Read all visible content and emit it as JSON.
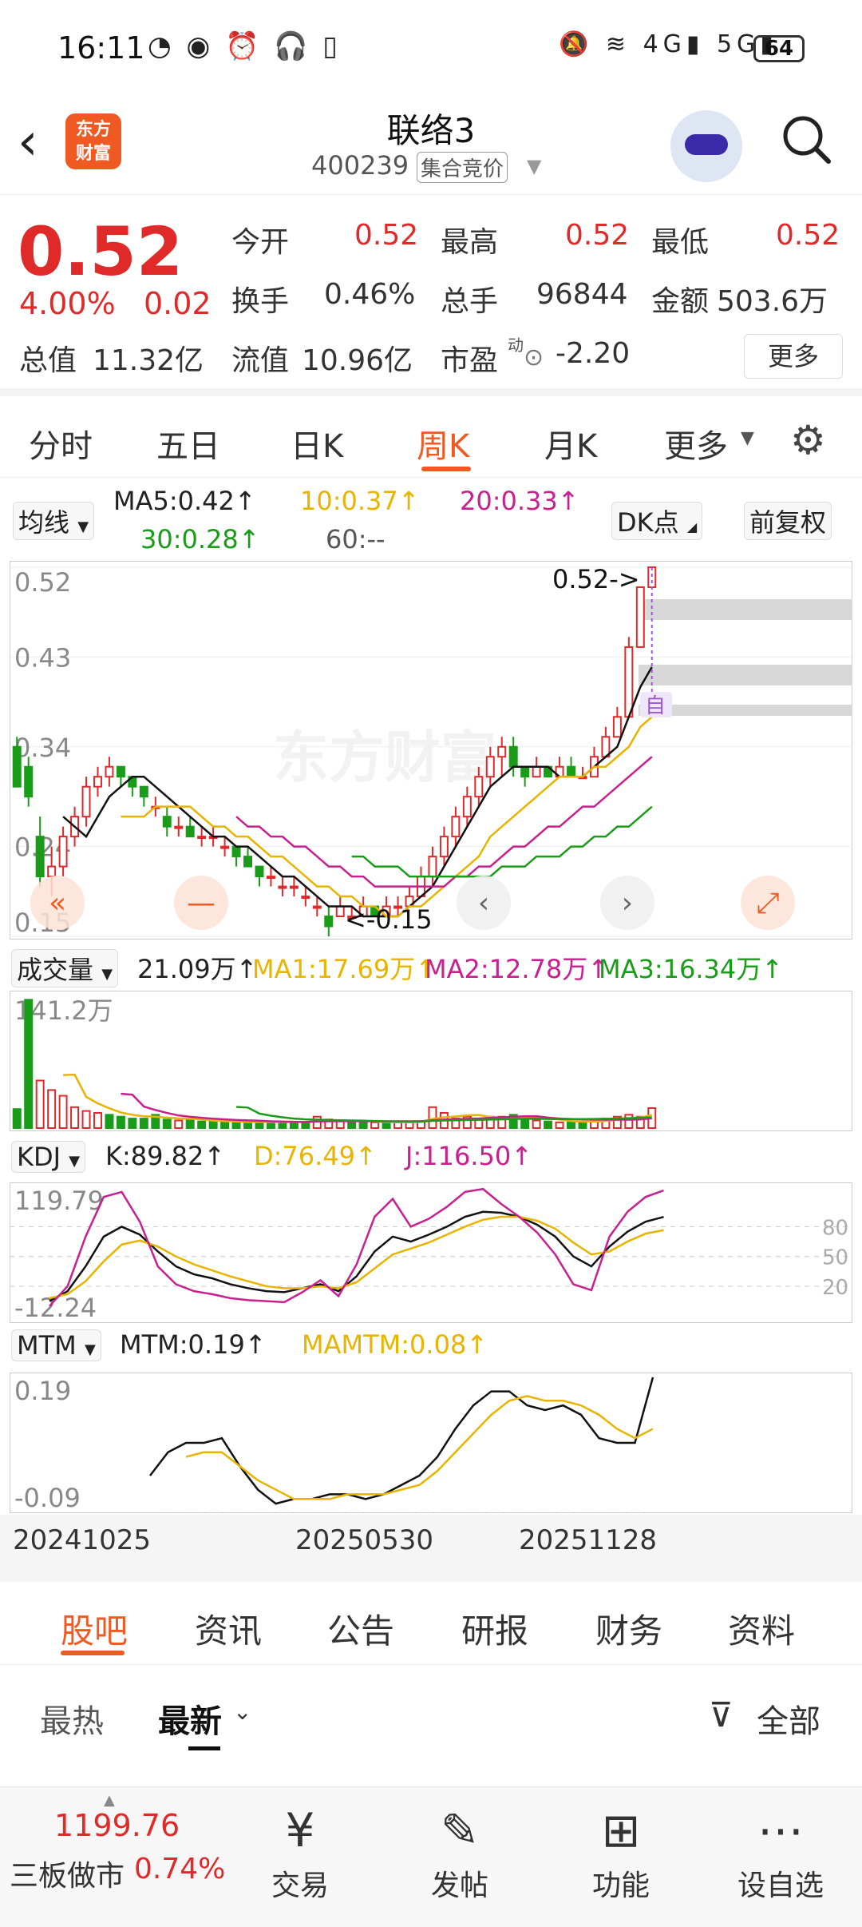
{
  "status_bar": {
    "time": "16:11",
    "left_icons": "◔ ◉ ⏰ 🎧 ▯",
    "right_icons": "🔕 ≋ 4G▮ 5G▮",
    "battery": "64"
  },
  "header": {
    "title": "联络3",
    "code": "400239",
    "badge": "集合竞价",
    "logo_text": "东方财富"
  },
  "quote": {
    "price": "0.52",
    "change_pct": "4.00%",
    "change": "0.02",
    "open_label": "今开",
    "open": "0.52",
    "high_label": "最高",
    "high": "0.52",
    "low_label": "最低",
    "low": "0.52",
    "turnover_label": "换手",
    "turnover": "0.46%",
    "volume_label": "总手",
    "volume": "96844",
    "amount_label": "金额",
    "amount": "503.6万",
    "total_cap_label": "总值",
    "total_cap": "11.32亿",
    "float_cap_label": "流值",
    "float_cap": "10.96亿",
    "pe_label": "市盈",
    "pe_sup": "动",
    "pe": "-2.20",
    "more_label": "更多"
  },
  "period_tabs": [
    "分时",
    "五日",
    "日K",
    "周K",
    "月K",
    "更多"
  ],
  "active_period": "周K",
  "kline_panel": {
    "indicator_label": "均线",
    "ma5": "MA5:0.42↑",
    "ma10": "10:0.37↑",
    "ma20": "20:0.33↑",
    "ma30": "30:0.28↑",
    "ma60": "60:--",
    "dk_label": "DK点",
    "adjust_label": "前复权",
    "y_labels": [
      "0.52",
      "0.43",
      "0.34",
      "0.24",
      "0.15"
    ],
    "max_marker": "0.52->",
    "min_marker": "<-0.15",
    "zi_label": "自",
    "watermark": "东方财富"
  },
  "volume_panel": {
    "label": "成交量",
    "value": "21.09万↑",
    "ma1": "MA1:17.69万↑",
    "ma2": "MA2:12.78万↑",
    "ma3": "MA3:16.34万↑",
    "y_max": "141.2万"
  },
  "kdj_panel": {
    "label": "KDJ",
    "k": "K:89.82↑",
    "d": "D:76.49↑",
    "j": "J:116.50↑",
    "y_top": "119.79",
    "y_bottom": "-12.24",
    "levels": [
      "80",
      "50",
      "20"
    ]
  },
  "mtm_panel": {
    "label": "MTM",
    "mtm": "MTM:0.19↑",
    "mamtm": "MAMTM:0.08↑",
    "y_top": "0.19",
    "y_bottom": "-0.09"
  },
  "x_dates": [
    "20241025",
    "20250530",
    "20251128"
  ],
  "bottom_tabs": [
    "股吧",
    "资讯",
    "公告",
    "研报",
    "财务",
    "资料"
  ],
  "active_bottom_tab": "股吧",
  "sub_tabs": {
    "hot": "最热",
    "latest": "最新",
    "filter": "全部"
  },
  "footer": {
    "index_value": "1199.76",
    "index_name": "三板做市",
    "index_pct": "0.74%",
    "items": [
      "交易",
      "发帖",
      "功能",
      "设自选"
    ]
  },
  "colors": {
    "up": "#e02a2a",
    "down": "#1a9c1a",
    "accent": "#ef5a23",
    "ma10": "#e8b400",
    "ma20": "#c8208e",
    "ma30": "#1a9c1a"
  },
  "chart_data": [
    {
      "type": "candlestick",
      "title": "",
      "ylim": [
        0.15,
        0.52
      ],
      "x_range": [
        "20241025",
        "20251128"
      ],
      "ohlc": [
        [
          0.34,
          0.35,
          0.3,
          0.3
        ],
        [
          0.32,
          0.33,
          0.28,
          0.29
        ],
        [
          0.25,
          0.27,
          0.2,
          0.21
        ],
        [
          0.21,
          0.24,
          0.19,
          0.22
        ],
        [
          0.22,
          0.26,
          0.21,
          0.25
        ],
        [
          0.25,
          0.28,
          0.24,
          0.27
        ],
        [
          0.27,
          0.31,
          0.26,
          0.3
        ],
        [
          0.3,
          0.32,
          0.29,
          0.31
        ],
        [
          0.31,
          0.33,
          0.3,
          0.32
        ],
        [
          0.32,
          0.32,
          0.3,
          0.31
        ],
        [
          0.31,
          0.31,
          0.29,
          0.3
        ],
        [
          0.3,
          0.3,
          0.28,
          0.29
        ],
        [
          0.28,
          0.29,
          0.27,
          0.28
        ],
        [
          0.27,
          0.28,
          0.25,
          0.26
        ],
        [
          0.26,
          0.27,
          0.25,
          0.26
        ],
        [
          0.26,
          0.27,
          0.25,
          0.25
        ],
        [
          0.25,
          0.26,
          0.24,
          0.25
        ],
        [
          0.25,
          0.26,
          0.24,
          0.25
        ],
        [
          0.24,
          0.25,
          0.23,
          0.24
        ],
        [
          0.24,
          0.24,
          0.22,
          0.23
        ],
        [
          0.23,
          0.24,
          0.22,
          0.22
        ],
        [
          0.22,
          0.22,
          0.2,
          0.21
        ],
        [
          0.21,
          0.22,
          0.2,
          0.21
        ],
        [
          0.2,
          0.21,
          0.19,
          0.2
        ],
        [
          0.2,
          0.21,
          0.19,
          0.2
        ],
        [
          0.19,
          0.2,
          0.18,
          0.19
        ],
        [
          0.18,
          0.19,
          0.17,
          0.18
        ],
        [
          0.17,
          0.18,
          0.15,
          0.16
        ],
        [
          0.17,
          0.19,
          0.17,
          0.18
        ],
        [
          0.17,
          0.18,
          0.17,
          0.17
        ],
        [
          0.17,
          0.19,
          0.17,
          0.18
        ],
        [
          0.18,
          0.18,
          0.17,
          0.17
        ],
        [
          0.17,
          0.19,
          0.17,
          0.18
        ],
        [
          0.18,
          0.19,
          0.17,
          0.18
        ],
        [
          0.18,
          0.2,
          0.18,
          0.19
        ],
        [
          0.19,
          0.22,
          0.19,
          0.21
        ],
        [
          0.21,
          0.24,
          0.2,
          0.23
        ],
        [
          0.23,
          0.26,
          0.22,
          0.25
        ],
        [
          0.25,
          0.28,
          0.24,
          0.27
        ],
        [
          0.27,
          0.3,
          0.26,
          0.29
        ],
        [
          0.29,
          0.32,
          0.28,
          0.31
        ],
        [
          0.31,
          0.34,
          0.3,
          0.33
        ],
        [
          0.33,
          0.35,
          0.31,
          0.34
        ],
        [
          0.34,
          0.35,
          0.31,
          0.32
        ],
        [
          0.32,
          0.32,
          0.3,
          0.31
        ],
        [
          0.31,
          0.33,
          0.31,
          0.32
        ],
        [
          0.32,
          0.32,
          0.31,
          0.31
        ],
        [
          0.31,
          0.33,
          0.31,
          0.32
        ],
        [
          0.32,
          0.33,
          0.31,
          0.31
        ],
        [
          0.31,
          0.32,
          0.31,
          0.31
        ],
        [
          0.31,
          0.34,
          0.31,
          0.33
        ],
        [
          0.33,
          0.36,
          0.33,
          0.35
        ],
        [
          0.35,
          0.38,
          0.35,
          0.37
        ],
        [
          0.37,
          0.45,
          0.37,
          0.44
        ],
        [
          0.44,
          0.5,
          0.44,
          0.5
        ],
        [
          0.5,
          0.52,
          0.5,
          0.52
        ]
      ],
      "ma_series": [
        {
          "name": "MA5",
          "values": [
            null,
            null,
            null,
            null,
            0.27,
            0.26,
            0.25,
            0.27,
            0.29,
            0.3,
            0.31,
            0.31,
            0.3,
            0.29,
            0.28,
            0.27,
            0.26,
            0.25,
            0.25,
            0.24,
            0.24,
            0.23,
            0.22,
            0.21,
            0.21,
            0.2,
            0.19,
            0.18,
            0.18,
            0.18,
            0.17,
            0.17,
            0.17,
            0.17,
            0.18,
            0.19,
            0.2,
            0.22,
            0.24,
            0.26,
            0.28,
            0.3,
            0.31,
            0.32,
            0.32,
            0.32,
            0.32,
            0.31,
            0.31,
            0.31,
            0.32,
            0.33,
            0.34,
            0.37,
            0.4,
            0.42
          ]
        },
        {
          "name": "MA10",
          "values": [
            null,
            null,
            null,
            null,
            null,
            null,
            null,
            null,
            null,
            0.27,
            0.27,
            0.27,
            0.28,
            0.28,
            0.28,
            0.28,
            0.27,
            0.26,
            0.26,
            0.25,
            0.25,
            0.24,
            0.23,
            0.23,
            0.22,
            0.21,
            0.2,
            0.2,
            0.19,
            0.19,
            0.18,
            0.18,
            0.17,
            0.17,
            0.18,
            0.18,
            0.19,
            0.2,
            0.21,
            0.22,
            0.23,
            0.25,
            0.26,
            0.27,
            0.28,
            0.29,
            0.3,
            0.31,
            0.31,
            0.31,
            0.32,
            0.32,
            0.33,
            0.34,
            0.36,
            0.37
          ]
        },
        {
          "name": "MA20",
          "values": [
            null,
            null,
            null,
            null,
            null,
            null,
            null,
            null,
            null,
            null,
            null,
            null,
            null,
            null,
            null,
            null,
            null,
            null,
            null,
            0.27,
            0.26,
            0.26,
            0.25,
            0.25,
            0.24,
            0.24,
            0.23,
            0.22,
            0.22,
            0.21,
            0.21,
            0.2,
            0.2,
            0.2,
            0.2,
            0.2,
            0.2,
            0.2,
            0.21,
            0.21,
            0.22,
            0.22,
            0.23,
            0.24,
            0.24,
            0.25,
            0.26,
            0.26,
            0.27,
            0.28,
            0.28,
            0.29,
            0.3,
            0.31,
            0.32,
            0.33
          ]
        },
        {
          "name": "MA30",
          "values": [
            null,
            null,
            null,
            null,
            null,
            null,
            null,
            null,
            null,
            null,
            null,
            null,
            null,
            null,
            null,
            null,
            null,
            null,
            null,
            null,
            null,
            null,
            null,
            null,
            null,
            null,
            null,
            null,
            null,
            0.23,
            0.23,
            0.22,
            0.22,
            0.22,
            0.21,
            0.21,
            0.21,
            0.21,
            0.21,
            0.21,
            0.21,
            0.21,
            0.22,
            0.22,
            0.22,
            0.23,
            0.23,
            0.23,
            0.24,
            0.24,
            0.25,
            0.25,
            0.26,
            0.26,
            0.27,
            0.28
          ]
        }
      ]
    },
    {
      "type": "bar",
      "title": "成交量",
      "ylim": [
        0,
        141.2
      ],
      "values": [
        20,
        135,
        50,
        40,
        34,
        22,
        18,
        16,
        14,
        12,
        10,
        10,
        14,
        9,
        8,
        8,
        7,
        7,
        6,
        6,
        6,
        7,
        7,
        6,
        6,
        6,
        12,
        9,
        7,
        6,
        6,
        6,
        7,
        6,
        6,
        7,
        22,
        16,
        10,
        12,
        9,
        12,
        12,
        14,
        10,
        8,
        7,
        6,
        6,
        7,
        8,
        10,
        12,
        14,
        12,
        21
      ],
      "directions": [
        "d",
        "d",
        "u",
        "u",
        "u",
        "u",
        "u",
        "u",
        "d",
        "d",
        "d",
        "d",
        "d",
        "d",
        "u",
        "d",
        "d",
        "d",
        "d",
        "d",
        "d",
        "d",
        "d",
        "d",
        "d",
        "d",
        "u",
        "u",
        "u",
        "d",
        "d",
        "u",
        "d",
        "u",
        "u",
        "u",
        "u",
        "u",
        "u",
        "u",
        "u",
        "u",
        "u",
        "d",
        "d",
        "u",
        "d",
        "u",
        "d",
        "d",
        "u",
        "u",
        "u",
        "u",
        "u",
        "u"
      ]
    },
    {
      "type": "line",
      "title": "KDJ",
      "ylim": [
        -12.24,
        119.79
      ],
      "series": [
        {
          "name": "K",
          "values": [
            5,
            15,
            40,
            70,
            80,
            72,
            55,
            40,
            32,
            28,
            22,
            18,
            15,
            14,
            18,
            22,
            15,
            30,
            55,
            70,
            65,
            72,
            80,
            90,
            95,
            94,
            90,
            82,
            70,
            50,
            40,
            60,
            75,
            85,
            89.82
          ]
        },
        {
          "name": "D",
          "values": [
            8,
            12,
            25,
            45,
            62,
            66,
            60,
            50,
            42,
            36,
            30,
            25,
            20,
            18,
            18,
            20,
            18,
            24,
            38,
            52,
            58,
            64,
            72,
            80,
            87,
            90,
            90,
            86,
            78,
            64,
            52,
            55,
            65,
            73,
            76.49
          ]
        },
        {
          "name": "J",
          "values": [
            0,
            20,
            70,
            110,
            115,
            85,
            40,
            22,
            15,
            12,
            8,
            6,
            5,
            4,
            14,
            26,
            10,
            42,
            90,
            108,
            80,
            88,
            100,
            115,
            118,
            103,
            90,
            74,
            52,
            22,
            16,
            70,
            95,
            110,
            116.5
          ]
        }
      ]
    },
    {
      "type": "line",
      "title": "MTM",
      "ylim": [
        -0.09,
        0.19
      ],
      "series": [
        {
          "name": "MTM",
          "values": [
            -0.02,
            0.03,
            0.05,
            0.05,
            0.06,
            0.0,
            -0.05,
            -0.08,
            -0.07,
            -0.07,
            -0.06,
            -0.06,
            -0.07,
            -0.06,
            -0.04,
            -0.02,
            0.02,
            0.08,
            0.13,
            0.16,
            0.16,
            0.13,
            0.12,
            0.13,
            0.11,
            0.06,
            0.05,
            0.05,
            0.19
          ]
        },
        {
          "name": "MAMTM",
          "values": [
            null,
            null,
            0.02,
            0.03,
            0.03,
            0.0,
            -0.03,
            -0.05,
            -0.07,
            -0.07,
            -0.07,
            -0.06,
            -0.06,
            -0.06,
            -0.05,
            -0.04,
            -0.01,
            0.03,
            0.07,
            0.11,
            0.14,
            0.15,
            0.14,
            0.14,
            0.13,
            0.11,
            0.08,
            0.06,
            0.08
          ]
        }
      ]
    }
  ]
}
